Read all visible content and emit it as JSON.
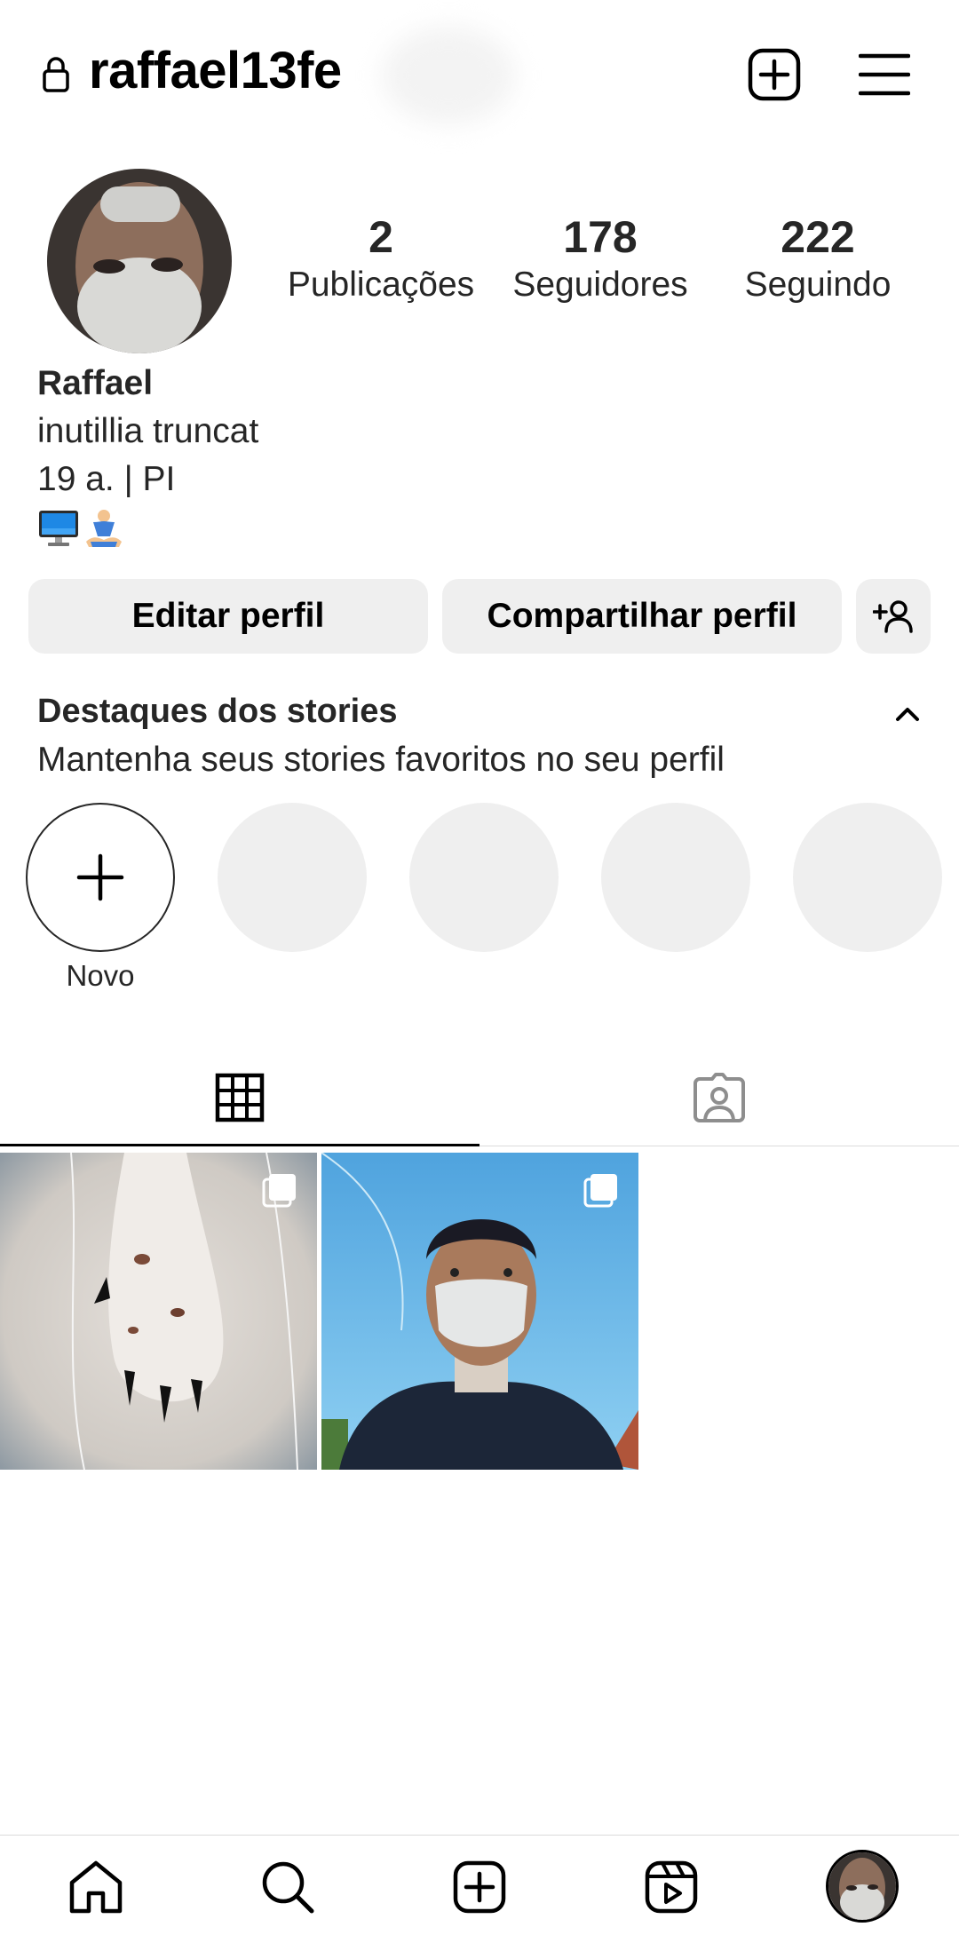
{
  "header": {
    "username": "raffael13fe",
    "lock_icon": "lock-icon",
    "create_icon": "plus-square-icon",
    "menu_icon": "hamburger-menu-icon"
  },
  "profile": {
    "stats": [
      {
        "value": "2",
        "label": "Publicações"
      },
      {
        "value": "178",
        "label": "Seguidores"
      },
      {
        "value": "222",
        "label": "Seguindo"
      }
    ],
    "name": "Raffael",
    "bio_line1": "inutillia truncat",
    "bio_line2": "19 a. | PI",
    "bio_emojis": [
      "computer-icon",
      "person-meditating-icon"
    ]
  },
  "actions": {
    "edit_label": "Editar perfil",
    "share_label": "Compartilhar perfil",
    "discover_icon": "add-person-icon"
  },
  "highlights": {
    "title": "Destaques dos stories",
    "subtitle": "Mantenha seus stories favoritos no seu perfil",
    "new_label": "Novo"
  },
  "tabs": [
    {
      "icon": "grid-icon",
      "active": true
    },
    {
      "icon": "tagged-person-icon",
      "active": false
    }
  ],
  "posts": [
    {
      "subject": "dog paw",
      "multiple": true
    },
    {
      "subject": "selfie with mask",
      "multiple": true
    }
  ],
  "bottom_nav": [
    "home-icon",
    "search-icon",
    "create-icon",
    "reels-icon",
    "profile-avatar"
  ],
  "colors": {
    "text": "#262626",
    "button_bg": "#efefef",
    "divider": "#dbdbdb"
  }
}
